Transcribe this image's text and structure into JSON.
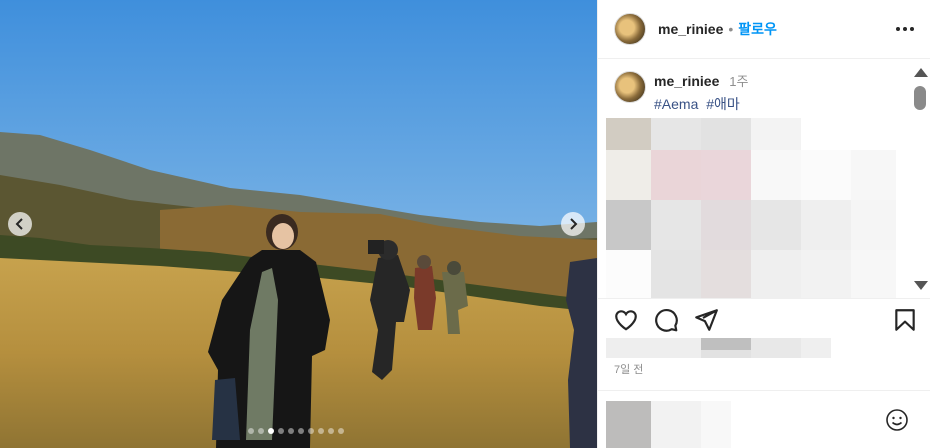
{
  "post": {
    "username": "me_riniee",
    "follow_label": "팔로우",
    "separator": "•"
  },
  "caption": {
    "username": "me_riniee",
    "time_ago": "1주",
    "hashtags": [
      "#Aema",
      "#애마"
    ]
  },
  "post_date": "7일 전",
  "carousel": {
    "slide_count": 10,
    "active_index": 2
  },
  "icons": {
    "more": "more-horizontal-icon",
    "like": "heart-icon",
    "comment": "comment-icon",
    "share": "paper-plane-icon",
    "save": "bookmark-icon",
    "emoji": "smiley-icon",
    "prev": "chevron-left-icon",
    "next": "chevron-right-icon"
  },
  "colors": {
    "follow_blue": "#0095f6",
    "hashtag_blue": "#385185",
    "secondary_text": "#8e8e8e"
  }
}
